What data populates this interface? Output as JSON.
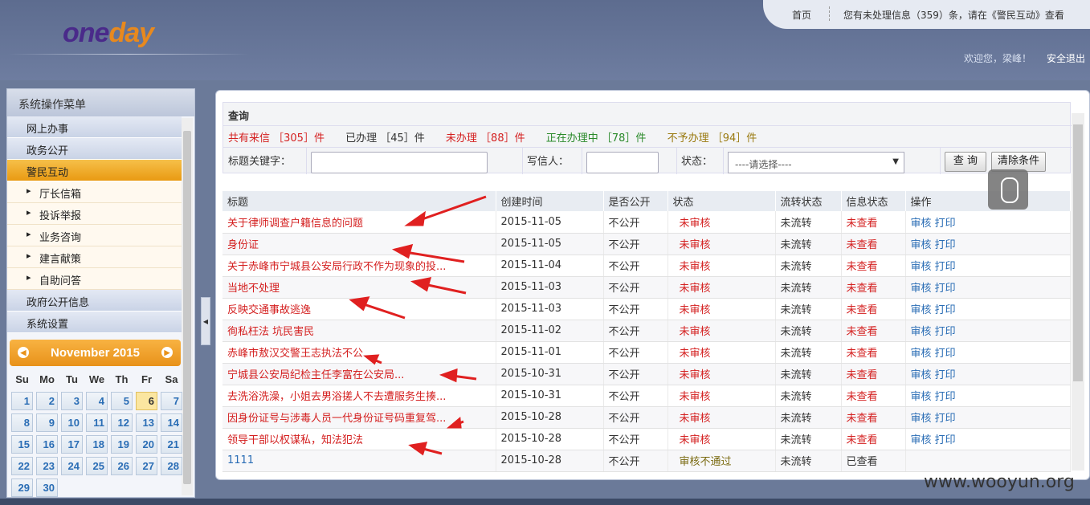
{
  "header": {
    "logo_part1": "one",
    "logo_part2": "day",
    "home_link": "首页",
    "notice": "您有未处理信息（359）条，请在《警民互动》查看",
    "welcome": "欢迎您，梁峰！",
    "logout": "安全退出"
  },
  "sidebar": {
    "title": "系统操作菜单",
    "categories": [
      {
        "label": "网上办事"
      },
      {
        "label": "政务公开"
      },
      {
        "label": "警民互动"
      }
    ],
    "subitems": [
      {
        "label": "厅长信箱"
      },
      {
        "label": "投诉举报"
      },
      {
        "label": "业务咨询"
      },
      {
        "label": "建言献策"
      },
      {
        "label": "自助问答"
      }
    ],
    "categories2": [
      {
        "label": "政府公开信息"
      },
      {
        "label": "系统设置"
      }
    ]
  },
  "calendar": {
    "month_label": "November 2015",
    "dow": [
      "Su",
      "Mo",
      "Tu",
      "We",
      "Th",
      "Fr",
      "Sa"
    ],
    "days": [
      "1",
      "2",
      "3",
      "4",
      "5",
      "6",
      "7",
      "8",
      "9",
      "10",
      "11",
      "12",
      "13",
      "14",
      "15",
      "16",
      "17",
      "18",
      "19",
      "20",
      "21",
      "22",
      "23",
      "24",
      "25",
      "26",
      "27",
      "28",
      "29",
      "30"
    ],
    "today": "6"
  },
  "query": {
    "title": "查询",
    "stats": {
      "total": "共有来信 ［305］件",
      "done": "已办理 ［45］件",
      "undone": "未办理 ［88］件",
      "processing": "正在办理中 ［78］件",
      "rejected": "不予办理 ［94］件"
    },
    "keyword_label": "标题关键字：",
    "writer_label": "写信人：",
    "status_label": "状态：",
    "status_value": "----请选择----",
    "search_btn": "查 询",
    "clear_btn": "清除条件"
  },
  "table": {
    "headers": [
      "标题",
      "创建时间",
      "是否公开",
      "状态",
      "流转状态",
      "信息状态",
      "操作"
    ],
    "rows": [
      {
        "title": "关于律师调查户籍信息的问题",
        "date": "2015-11-05",
        "public": "不公开",
        "status": "未审核",
        "flow": "未流转",
        "info": "未查看",
        "action": "审核 打印"
      },
      {
        "title": "身份证",
        "date": "2015-11-05",
        "public": "不公开",
        "status": "未审核",
        "flow": "未流转",
        "info": "未查看",
        "action": "审核 打印"
      },
      {
        "title": "关于赤峰市宁城县公安局行政不作为现象的投...",
        "date": "2015-11-04",
        "public": "不公开",
        "status": "未审核",
        "flow": "未流转",
        "info": "未查看",
        "action": "审核 打印"
      },
      {
        "title": "当地不处理",
        "date": "2015-11-03",
        "public": "不公开",
        "status": "未审核",
        "flow": "未流转",
        "info": "未查看",
        "action": "审核 打印"
      },
      {
        "title": "反映交通事故逃逸",
        "date": "2015-11-03",
        "public": "不公开",
        "status": "未审核",
        "flow": "未流转",
        "info": "未查看",
        "action": "审核 打印"
      },
      {
        "title": "徇私枉法 坑民害民",
        "date": "2015-11-02",
        "public": "不公开",
        "status": "未审核",
        "flow": "未流转",
        "info": "未查看",
        "action": "审核 打印"
      },
      {
        "title": "赤峰市敖汉交警王志执法不公",
        "date": "2015-11-01",
        "public": "不公开",
        "status": "未审核",
        "flow": "未流转",
        "info": "未查看",
        "action": "审核 打印"
      },
      {
        "title": "宁城县公安局纪检主任李富在公安局...",
        "date": "2015-10-31",
        "public": "不公开",
        "status": "未审核",
        "flow": "未流转",
        "info": "未查看",
        "action": "审核 打印"
      },
      {
        "title": "去洗浴洗澡，小姐去男浴搓人不去遭服务生揍...",
        "date": "2015-10-31",
        "public": "不公开",
        "status": "未审核",
        "flow": "未流转",
        "info": "未查看",
        "action": "审核 打印"
      },
      {
        "title": "因身份证号与涉毒人员一代身份证号码重复驾...",
        "date": "2015-10-28",
        "public": "不公开",
        "status": "未审核",
        "flow": "未流转",
        "info": "未查看",
        "action": "审核 打印"
      },
      {
        "title": "领导干部以权谋私，知法犯法",
        "date": "2015-10-28",
        "public": "不公开",
        "status": "未审核",
        "flow": "未流转",
        "info": "未查看",
        "action": "审核 打印"
      },
      {
        "title": "1111",
        "date": "2015-10-28",
        "public": "不公开",
        "status": "审核不通过",
        "flow": "未流转",
        "info": "已查看",
        "action": ""
      }
    ]
  },
  "watermark": "www.wooyun.org"
}
